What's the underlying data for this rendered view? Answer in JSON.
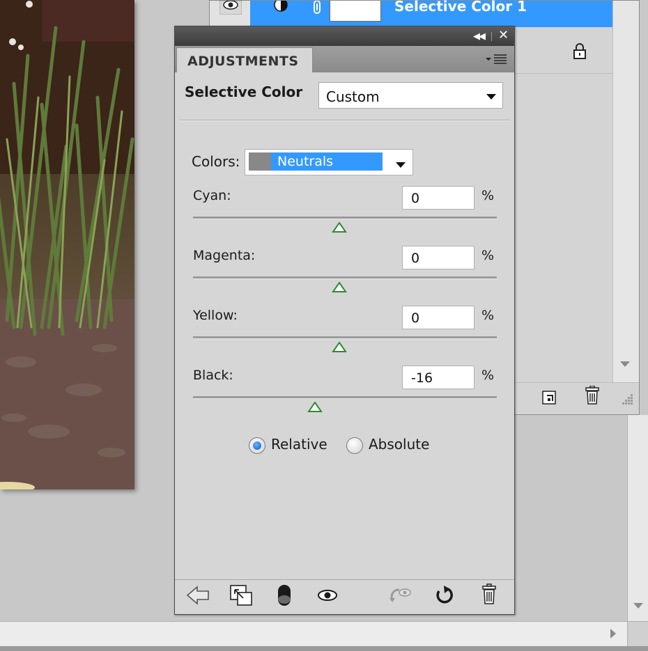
{
  "layers_panel": {
    "selected_layer_name": "Selective Color 1"
  },
  "adjustments": {
    "tab_label": "ADJUSTMENTS",
    "preset": {
      "label": "Selective Color",
      "value": "Custom"
    },
    "colors": {
      "label": "Colors:",
      "value": "Neutrals",
      "swatch_color": "#888888"
    },
    "sliders": [
      {
        "label": "Cyan:",
        "value": "0",
        "unit": "%",
        "level": 0
      },
      {
        "label": "Magenta:",
        "value": "0",
        "unit": "%",
        "level": 0
      },
      {
        "label": "Yellow:",
        "value": "0",
        "unit": "%",
        "level": 0
      },
      {
        "label": "Black:",
        "value": "-16",
        "unit": "%",
        "level": -16
      }
    ],
    "mode": {
      "options": [
        "Relative",
        "Absolute"
      ],
      "selected": "Relative"
    },
    "footer_icons": [
      "back-arrow-icon",
      "clip-to-layer-icon",
      "visibility-toggle-icon",
      "eye-icon",
      "view-previous-state-icon",
      "reset-icon",
      "trash-icon"
    ]
  },
  "colors": {
    "selection": "#3399ff",
    "panel_bg": "#d6d6d6",
    "slider_thumb": "#2e8b2e"
  }
}
